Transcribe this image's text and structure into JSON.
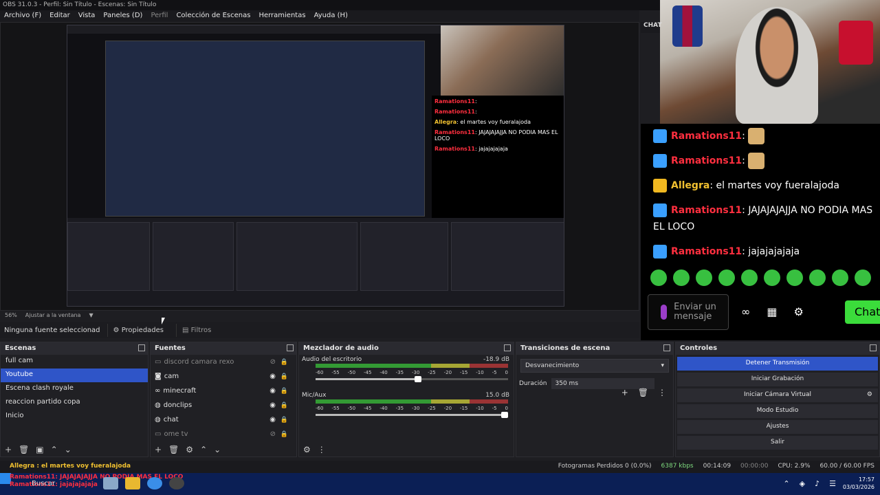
{
  "window": {
    "title": "OBS 31.0.3 - Perfil: Sin Título - Escenas: Sin Título"
  },
  "menu": [
    "Archivo (F)",
    "Editar",
    "Vista",
    "Paneles (D)",
    "Perfil",
    "Colección de Escenas",
    "Herramientas",
    "Ayuda (H)"
  ],
  "preview": {
    "zoom": "56%",
    "fit": "Ajustar a la ventana"
  },
  "source_bar": {
    "none": "Ninguna fuente seleccionad",
    "properties": "Propiedades",
    "filters": "Filtros"
  },
  "chat_header": "CHAT",
  "chat": {
    "messages": [
      {
        "user": "Ramations11",
        "text": ":",
        "badge": "blue",
        "emote": true
      },
      {
        "user": "Ramations11",
        "text": ":",
        "badge": "blue",
        "emote": true
      },
      {
        "user": "Allegra",
        "text": ": el martes voy fueralajoda",
        "badge": "crown",
        "emote": false
      },
      {
        "user": "Ramations11",
        "text": ": JAJAJAJAJJA NO PODIA MAS EL LOCO",
        "badge": "blue",
        "emote": false
      },
      {
        "user": "Ramations11",
        "text": ": jajajajajaja",
        "badge": "blue",
        "emote": false
      }
    ],
    "input_placeholder": "Enviar un mensaje",
    "chat_button": "Chat",
    "colors": {
      "mention": "#ff2f3f",
      "vip": "#f0c030",
      "button": "#3bdc3b"
    }
  },
  "docks": {
    "scenes": {
      "title": "Escenas",
      "items": [
        "full cam",
        "Youtube",
        "Escena clash royale",
        "reaccion partido copa",
        "Inicio"
      ],
      "selected": 1
    },
    "sources": {
      "title": "Fuentes",
      "items": [
        "discord camara rexo",
        "cam",
        "minecraft",
        "donclips",
        "chat",
        "ome tv"
      ]
    },
    "mixer": {
      "title": "Mezclador de audio",
      "channels": [
        {
          "name": "Audio del escritorio",
          "db": "-18.9 dB",
          "level": 0.55
        },
        {
          "name": "Mic/Aux",
          "db": "15.0 dB",
          "level": 1.0
        }
      ],
      "ticks": [
        "-60",
        "-55",
        "-50",
        "-45",
        "-40",
        "-35",
        "-30",
        "-25",
        "-20",
        "-15",
        "-10",
        "-5",
        "0"
      ]
    },
    "transitions": {
      "title": "Transiciones de escena",
      "type": "Desvanecimiento",
      "duration_label": "Duración",
      "duration": "350 ms"
    },
    "controls": {
      "title": "Controles",
      "buttons": [
        "Detener Transmisión",
        "Iniciar Grabación",
        "Iniciar Cámara Virtual",
        "Modo Estudio",
        "Ajustes",
        "Salir"
      ]
    }
  },
  "status": {
    "ticker": "Allegra : el martes voy fueralajoda",
    "dropped": "Fotogramas Perdidos 0 (0.0%)",
    "bitrate": "6387 kbps",
    "stream_time": "00:14:09",
    "rec_time": "00:00:00",
    "cpu": "CPU: 2.9%",
    "fps": "60.00 / 60.00 FPS"
  },
  "taskbar": {
    "overlay_line1": "Ramations11: JAJAJAJAJJA NO PODIA MAS EL LOCO",
    "overlay_line2": "Ramations11: jajajajajaja",
    "search": "Buscar",
    "time": "17:57",
    "date": "03/03/2026"
  }
}
